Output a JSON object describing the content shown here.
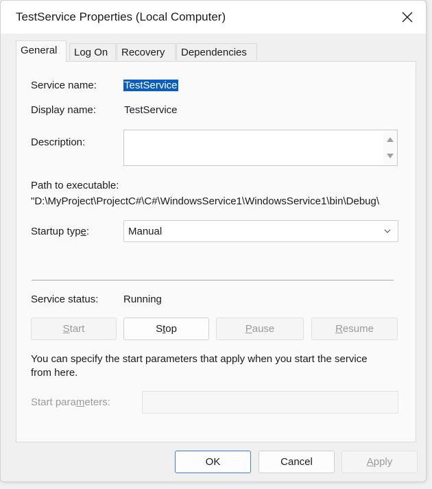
{
  "window": {
    "title": "TestService Properties (Local Computer)"
  },
  "tabs": [
    {
      "label": "General"
    },
    {
      "label": "Log On"
    },
    {
      "label": "Recovery"
    },
    {
      "label": "Dependencies"
    }
  ],
  "general": {
    "service_name_label": "Service name:",
    "service_name_value": "TestService",
    "display_name_label": "Display name:",
    "display_name_value": "TestService",
    "description_label": "Description:",
    "description_value": "",
    "path_label": "Path to executable:",
    "path_value": "\"D:\\MyProject\\ProjectC#\\C#\\WindowsService1\\WindowsService1\\bin\\Debug\\",
    "startup_type_label_pre": "Startup typ",
    "startup_type_label_ul": "e",
    "startup_type_label_post": ":",
    "startup_type_value": "Manual",
    "service_status_label": "Service status:",
    "service_status_value": "Running",
    "buttons": {
      "start_ul": "S",
      "start_rest": "tart",
      "stop_pre": "S",
      "stop_ul": "t",
      "stop_rest": "op",
      "pause_ul": "P",
      "pause_rest": "ause",
      "resume_ul": "R",
      "resume_rest": "esume"
    },
    "hint_line1": "You can specify the start parameters that apply when you start the service",
    "hint_line2": "from here.",
    "start_params_pre": "Start para",
    "start_params_ul": "m",
    "start_params_post": "eters:",
    "start_params_value": ""
  },
  "footer": {
    "ok": "OK",
    "cancel": "Cancel",
    "apply_ul": "A",
    "apply_rest": "pply"
  },
  "colors": {
    "selection": "#0a5dc2",
    "primary_border": "#3c7fcf"
  }
}
